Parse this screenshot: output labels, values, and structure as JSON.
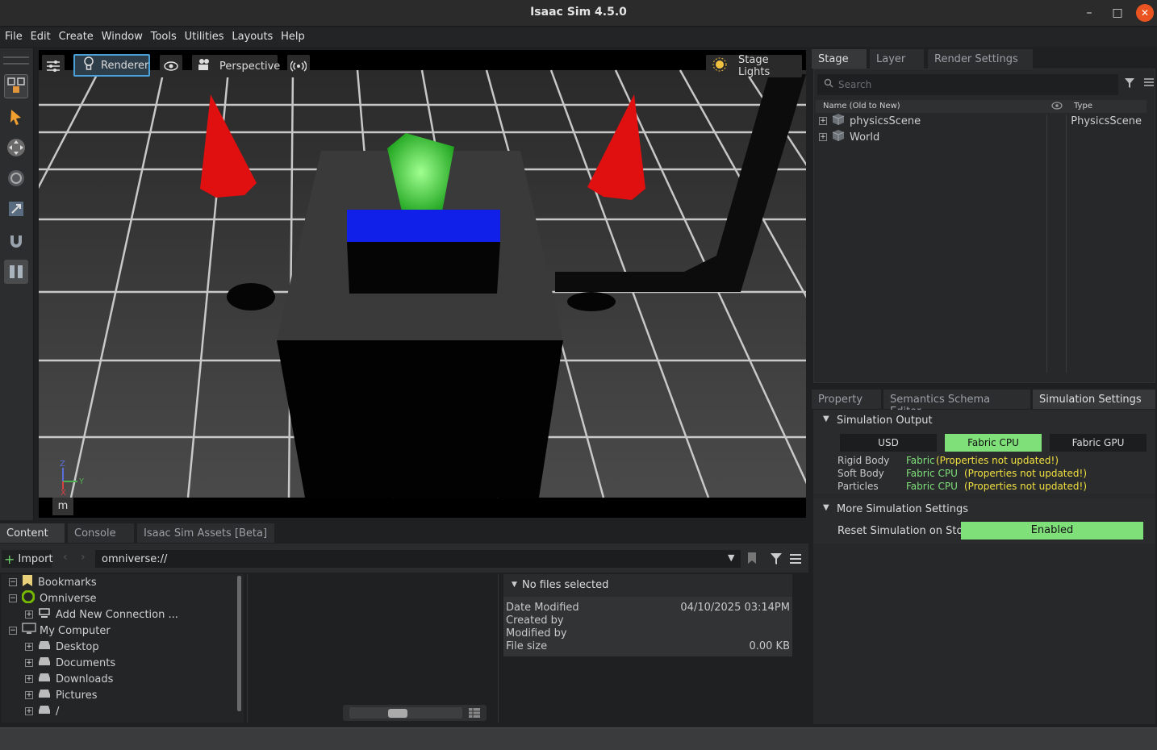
{
  "window": {
    "title": "Isaac Sim 4.5.0"
  },
  "menu": [
    "File",
    "Edit",
    "Create",
    "Window",
    "Tools",
    "Utilities",
    "Layouts",
    "Help"
  ],
  "viewport": {
    "renderer_label": "Renderer",
    "camera_label": "Perspective",
    "lights_label": "Stage Lights",
    "units_label": "m",
    "axis": {
      "z": "Z",
      "y": "Y",
      "x": "X"
    }
  },
  "stage": {
    "tabs": [
      "Stage",
      "Layer",
      "Render Settings"
    ],
    "search_placeholder": "Search",
    "col_name": "Name (Old to New)",
    "col_type": "Type",
    "items": [
      {
        "name": "physicsScene",
        "type": "PhysicsScene"
      },
      {
        "name": "World",
        "type": ""
      }
    ]
  },
  "property": {
    "tabs": [
      "Property",
      "Semantics Schema Editor",
      "Simulation Settings"
    ],
    "sim_output_header": "Simulation Output",
    "output_options": [
      "USD",
      "Fabric CPU",
      "Fabric GPU"
    ],
    "rows": [
      {
        "label": "Rigid Body",
        "value": "Fabric",
        "note": "(Properties not updated!)"
      },
      {
        "label": "Soft Body",
        "value": "Fabric CPU",
        "note": "(Properties not updated!)"
      },
      {
        "label": "Particles",
        "value": "Fabric CPU",
        "note": "(Properties not updated!)"
      }
    ],
    "more_header": "More Simulation Settings",
    "reset_label": "Reset Simulation on Stop",
    "reset_value": "Enabled"
  },
  "content": {
    "tabs": [
      "Content",
      "Console",
      "Isaac Sim Assets [Beta]"
    ],
    "import_label": "Import",
    "path": "omniverse://",
    "tree": [
      {
        "label": "Bookmarks",
        "indent": 0,
        "sign": "−"
      },
      {
        "label": "Omniverse",
        "indent": 0,
        "sign": "−"
      },
      {
        "label": "Add New Connection ...",
        "indent": 1,
        "sign": "+"
      },
      {
        "label": "My Computer",
        "indent": 0,
        "sign": "−"
      },
      {
        "label": "Desktop",
        "indent": 1,
        "sign": "+"
      },
      {
        "label": "Documents",
        "indent": 1,
        "sign": "+"
      },
      {
        "label": "Downloads",
        "indent": 1,
        "sign": "+"
      },
      {
        "label": "Pictures",
        "indent": 1,
        "sign": "+"
      },
      {
        "label": "/",
        "indent": 1,
        "sign": "+"
      }
    ],
    "details": {
      "header": "No files selected",
      "date_label": "Date Modified",
      "date_value": "04/10/2025 03:14PM",
      "created_label": "Created by",
      "modified_label": "Modified by",
      "size_label": "File size",
      "size_value": "0.00 KB"
    }
  }
}
